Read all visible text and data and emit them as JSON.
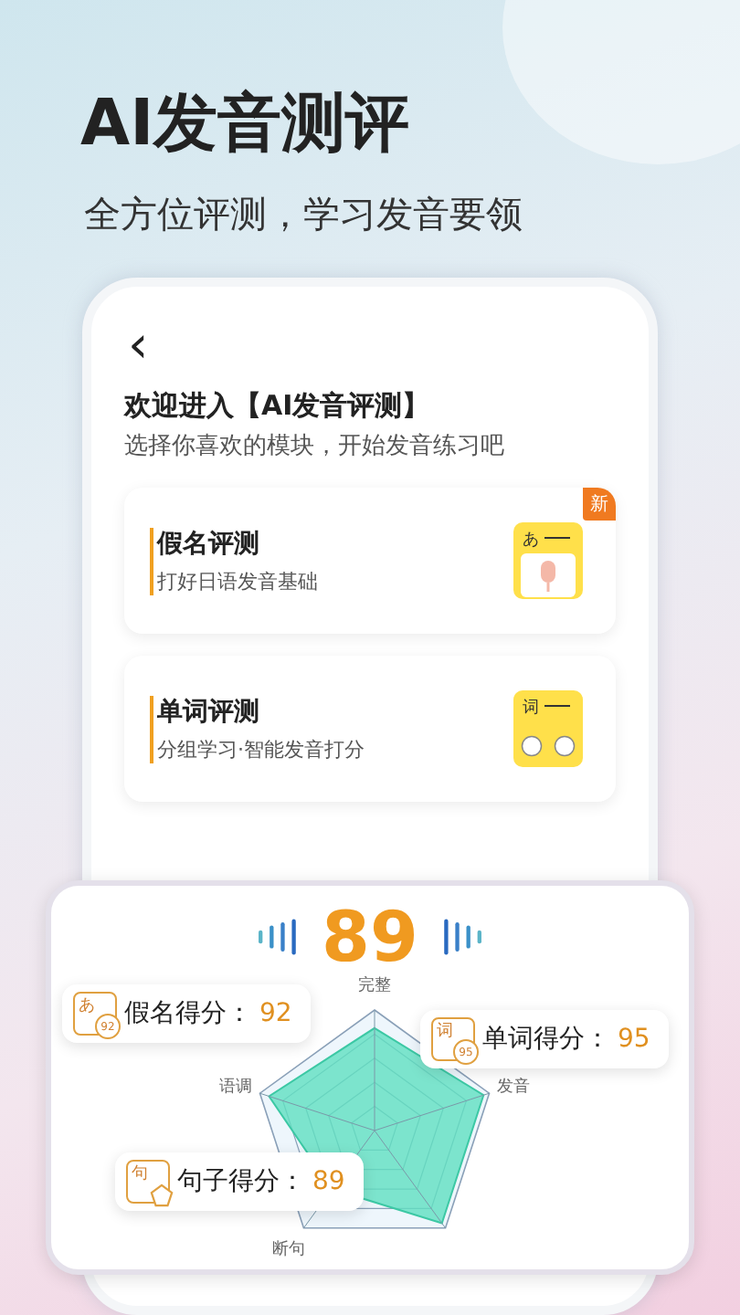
{
  "headline": "AI发音测评",
  "tagline": "全方位评测，学习发音要领",
  "screen": {
    "back_icon": "‹",
    "welcome": "欢迎进入【AI发音评测】",
    "instruction": "选择你喜欢的模块，开始发音练习吧",
    "modules": [
      {
        "kind": "kana",
        "title": "假名评测",
        "subtitle": "打好日语发音基础",
        "badge": "新",
        "icon_text": "あ"
      },
      {
        "kind": "word",
        "title": "单词评测",
        "subtitle": "分组学习·智能发音打分",
        "icon_text": "词"
      }
    ]
  },
  "score_panel": {
    "total": "89",
    "radar_axes": [
      "完整",
      "发音",
      "断句",
      "语调"
    ],
    "scores": [
      {
        "kind": "kana",
        "icon_text": "あ",
        "icon_score": "92",
        "label": "假名得分：",
        "value": "92"
      },
      {
        "kind": "word",
        "icon_text": "词",
        "icon_score": "95",
        "label": "单词得分：",
        "value": "95"
      },
      {
        "kind": "sentence",
        "icon_text": "句",
        "label": "句子得分：",
        "value": "89"
      }
    ]
  }
}
